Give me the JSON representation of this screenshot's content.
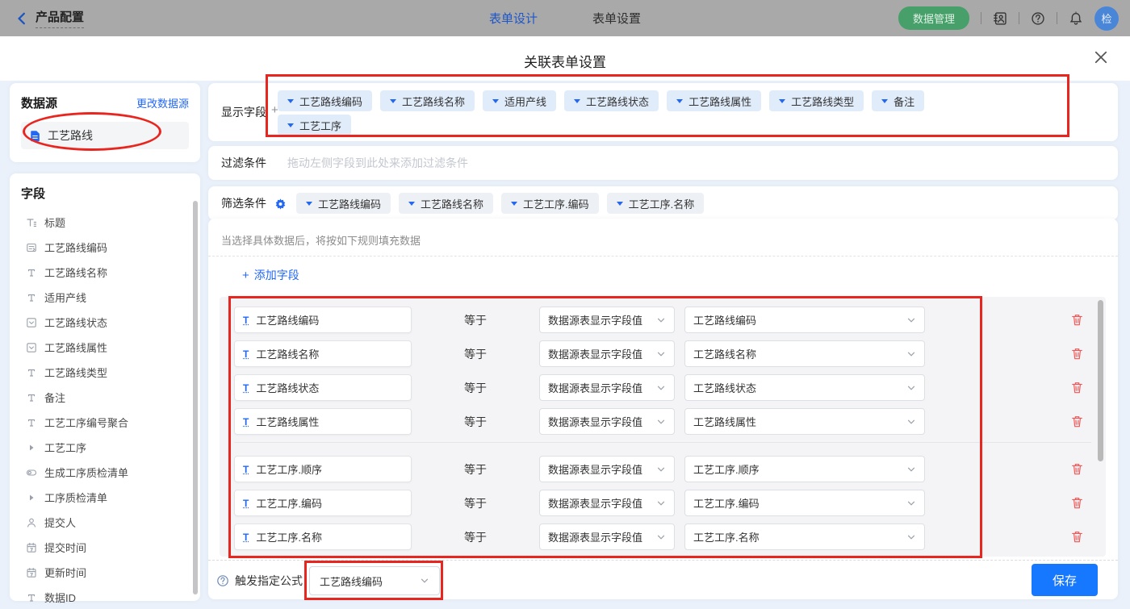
{
  "topbar": {
    "back_label": "产品配置",
    "tabs": [
      {
        "label": "表单设计",
        "active": true
      },
      {
        "label": "表单设置",
        "active": false
      }
    ],
    "data_manage_label": "数据管理",
    "avatar_text": "检",
    "icons": [
      "back-chevron-icon",
      "contact-book-icon",
      "question-circle-icon",
      "bell-icon"
    ]
  },
  "modal": {
    "title": "关联表单设置",
    "close_icon": "close-icon"
  },
  "datasource_panel": {
    "title": "数据源",
    "change_link": "更改数据源",
    "item": {
      "label": "工艺路线",
      "icon": "document-icon"
    }
  },
  "fields_panel": {
    "title": "字段",
    "fields": [
      {
        "label": "标题",
        "icon": "title-icon"
      },
      {
        "label": "工艺路线编码",
        "icon": "serial-icon"
      },
      {
        "label": "工艺路线名称",
        "icon": "text-icon"
      },
      {
        "label": "适用产线",
        "icon": "text-icon"
      },
      {
        "label": "工艺路线状态",
        "icon": "select-icon"
      },
      {
        "label": "工艺路线属性",
        "icon": "select-icon"
      },
      {
        "label": "工艺路线类型",
        "icon": "text-icon"
      },
      {
        "label": "备注",
        "icon": "text-icon"
      },
      {
        "label": "工艺工序编号聚合",
        "icon": "text-icon"
      },
      {
        "label": "工艺工序",
        "icon": "expand-arrow-icon"
      },
      {
        "label": "生成工序质检清单",
        "icon": "switch-icon"
      },
      {
        "label": "工序质检清单",
        "icon": "expand-arrow-icon"
      },
      {
        "label": "提交人",
        "icon": "person-icon"
      },
      {
        "label": "提交时间",
        "icon": "calendar-icon"
      },
      {
        "label": "更新时间",
        "icon": "calendar-icon"
      },
      {
        "label": "数据ID",
        "icon": "text-icon"
      }
    ]
  },
  "display_fields": {
    "label": "显示字段",
    "plus": "+",
    "tags": [
      "工艺路线编码",
      "工艺路线名称",
      "适用产线",
      "工艺路线状态",
      "工艺路线属性",
      "工艺路线类型",
      "备注",
      "工艺工序"
    ]
  },
  "filter_condition": {
    "label": "过滤条件",
    "placeholder": "拖动左侧字段到此处来添加过滤条件"
  },
  "screen_condition": {
    "label": "筛选条件",
    "tags": [
      "工艺路线编码",
      "工艺路线名称",
      "工艺工序.编码",
      "工艺工序.名称"
    ]
  },
  "rules": {
    "hint": "当选择具体数据后，将按如下规则填充数据",
    "add_plus": "+",
    "add_label": "添加字段",
    "group1": [
      {
        "field": "工艺路线编码",
        "relation": "等于",
        "source": "数据源表显示字段值",
        "target": "工艺路线编码"
      },
      {
        "field": "工艺路线名称",
        "relation": "等于",
        "source": "数据源表显示字段值",
        "target": "工艺路线名称"
      },
      {
        "field": "工艺路线状态",
        "relation": "等于",
        "source": "数据源表显示字段值",
        "target": "工艺路线状态"
      },
      {
        "field": "工艺路线属性",
        "relation": "等于",
        "source": "数据源表显示字段值",
        "target": "工艺路线属性"
      }
    ],
    "group2": [
      {
        "field": "工艺工序.顺序",
        "relation": "等于",
        "source": "数据源表显示字段值",
        "target": "工艺工序.顺序"
      },
      {
        "field": "工艺工序.编码",
        "relation": "等于",
        "source": "数据源表显示字段值",
        "target": "工艺工序.编码"
      },
      {
        "field": "工艺工序.名称",
        "relation": "等于",
        "source": "数据源表显示字段值",
        "target": "工艺工序.名称"
      }
    ]
  },
  "footer": {
    "trigger_label": "触发指定公式",
    "trigger_value": "工艺路线编码",
    "save_label": "保存"
  },
  "colors": {
    "accent_blue": "#2468f2",
    "tag_blue_bg": "#e1ecfb",
    "tag_gray_bg": "#edf0f5",
    "save_button": "#1677ff",
    "trash_red": "#f25555",
    "annotation_red": "#e8251f",
    "green_button": "#47a06a",
    "body_bg": "#eaf1fb"
  }
}
